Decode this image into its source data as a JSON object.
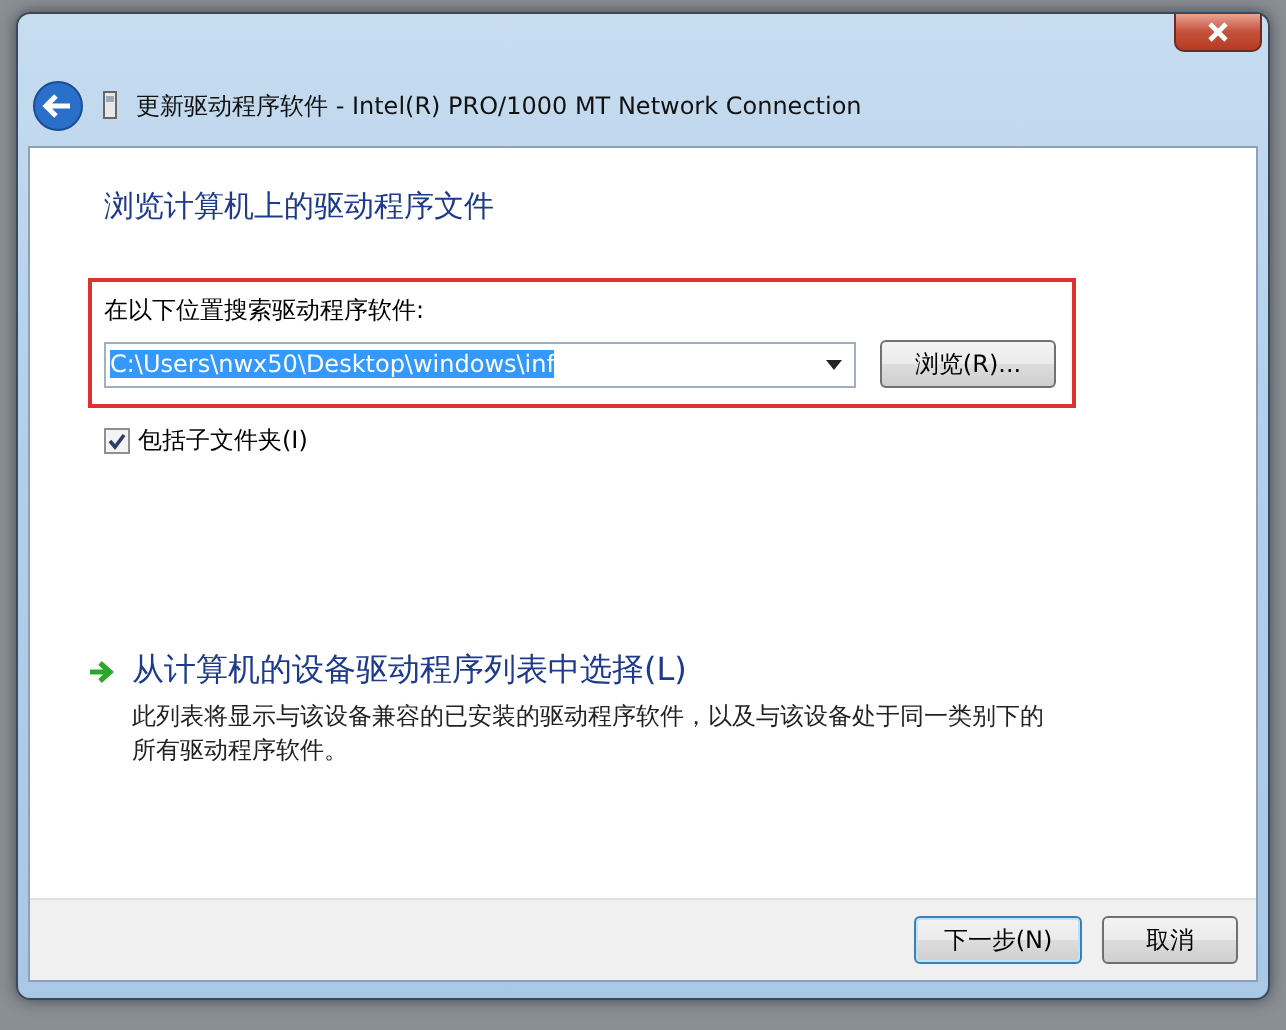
{
  "window": {
    "title": "更新驱动程序软件 - Intel(R) PRO/1000 MT Network Connection"
  },
  "heading": "浏览计算机上的驱动程序文件",
  "search": {
    "label": "在以下位置搜索驱动程序软件:",
    "path": "C:\\Users\\nwx50\\Desktop\\windows\\inf",
    "path_selected": true,
    "browse": "浏览(R)..."
  },
  "include_subfolders": {
    "label": "包括子文件夹(I)",
    "checked": true
  },
  "pick_option": {
    "title": "从计算机的设备驱动程序列表中选择(L)",
    "description": "此列表将显示与该设备兼容的已安装的驱动程序软件，以及与该设备处于同一类别下的所有驱动程序软件。"
  },
  "buttons": [
    {
      "label": "下一步(N)",
      "default": true
    },
    {
      "label": "取消",
      "default": false
    }
  ]
}
